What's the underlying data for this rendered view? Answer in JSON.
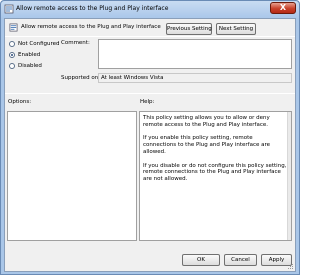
{
  "window": {
    "title": "Allow remote access to the Plug and Play interface",
    "close_glyph": "X"
  },
  "header": {
    "policy_name": "Allow remote access to the Plug and Play interface",
    "previous_label": "Previous Setting",
    "next_label": "Next Setting"
  },
  "state": {
    "options": [
      {
        "label": "Not Configured",
        "checked": false
      },
      {
        "label": "Enabled",
        "checked": true
      },
      {
        "label": "Disabled",
        "checked": false
      }
    ]
  },
  "comment": {
    "label": "Comment:",
    "value": ""
  },
  "supported": {
    "label": "Supported on:",
    "value": "At least Windows Vista"
  },
  "options_panel": {
    "label": "Options:"
  },
  "help_panel": {
    "label": "Help:",
    "paragraphs": [
      "This policy setting allows you to allow or deny remote access to the Plug and Play interface.",
      "If you enable this policy setting, remote connections to the Plug and Play interface are allowed.",
      "If you disable or do not configure this policy setting, remote connections to the Plug and Play interface are not allowed."
    ]
  },
  "footer": {
    "ok_label": "OK",
    "cancel_label": "Cancel",
    "apply_label": "Apply"
  }
}
